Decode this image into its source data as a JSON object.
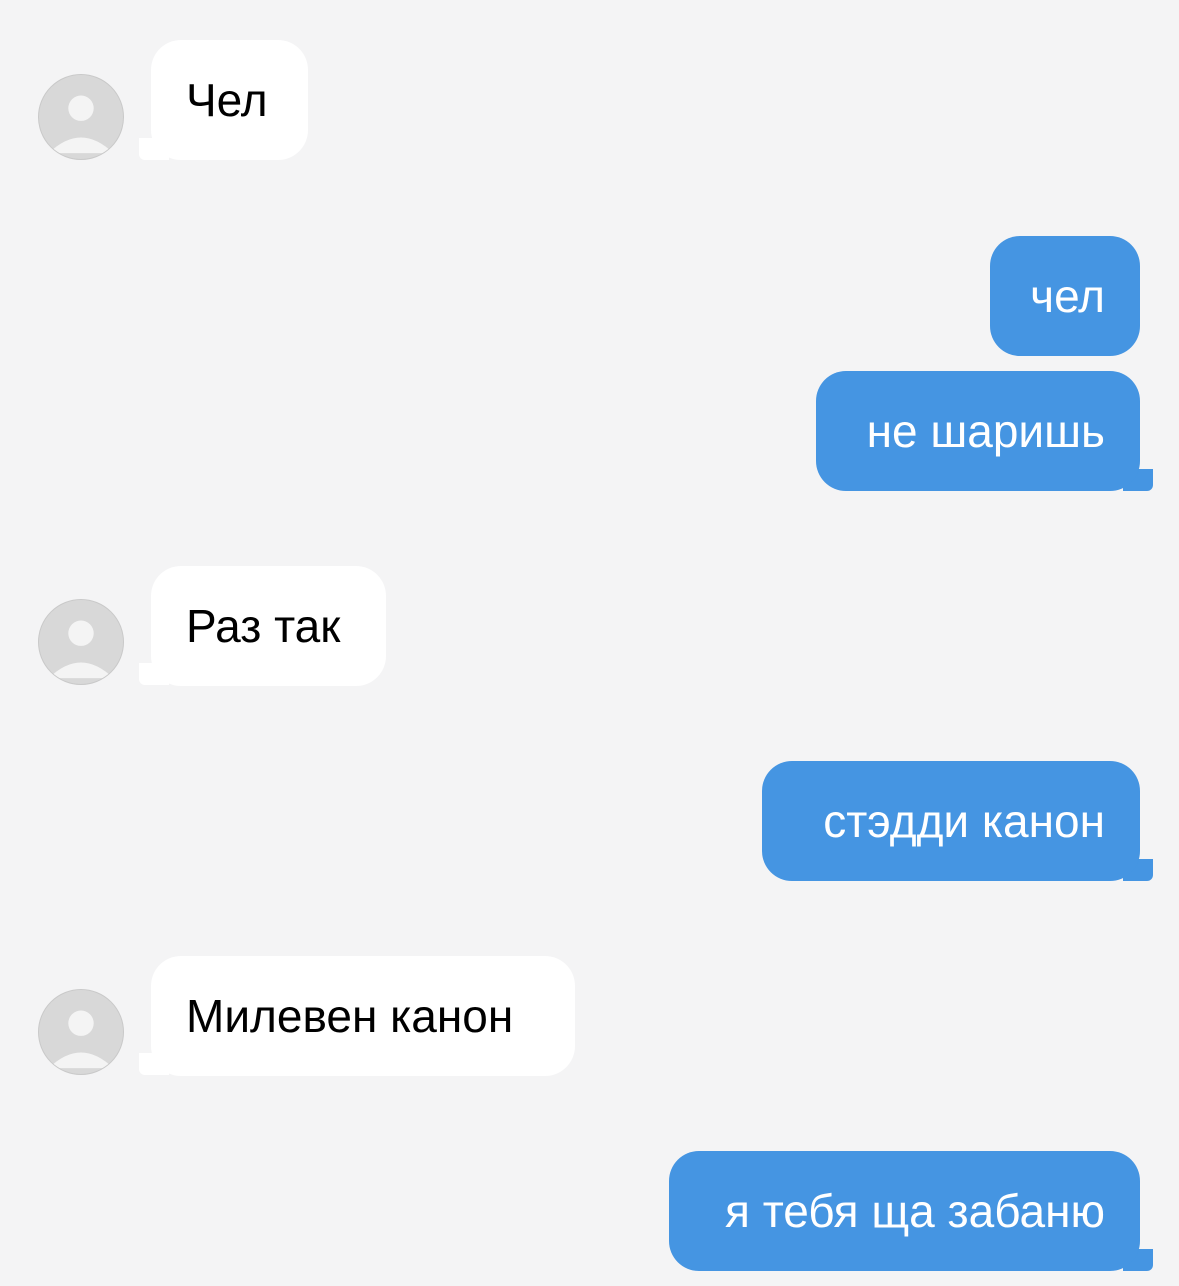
{
  "colors": {
    "background": "#f4f4f5",
    "incoming_bubble": "#ffffff",
    "outgoing_bubble": "#4595e2",
    "avatar_placeholder": "#d8d8d8"
  },
  "messages": [
    {
      "direction": "incoming",
      "avatar": "default-avatar-icon",
      "text": "Чел"
    },
    {
      "direction": "outgoing",
      "text": "чел"
    },
    {
      "direction": "outgoing",
      "text": "не шаришь"
    },
    {
      "direction": "incoming",
      "avatar": "default-avatar-icon",
      "text": "Раз так"
    },
    {
      "direction": "outgoing",
      "text": "стэдди канон"
    },
    {
      "direction": "incoming",
      "avatar": "default-avatar-icon",
      "text": "Милевен канон"
    },
    {
      "direction": "outgoing",
      "text": "я тебя ща забаню"
    }
  ]
}
